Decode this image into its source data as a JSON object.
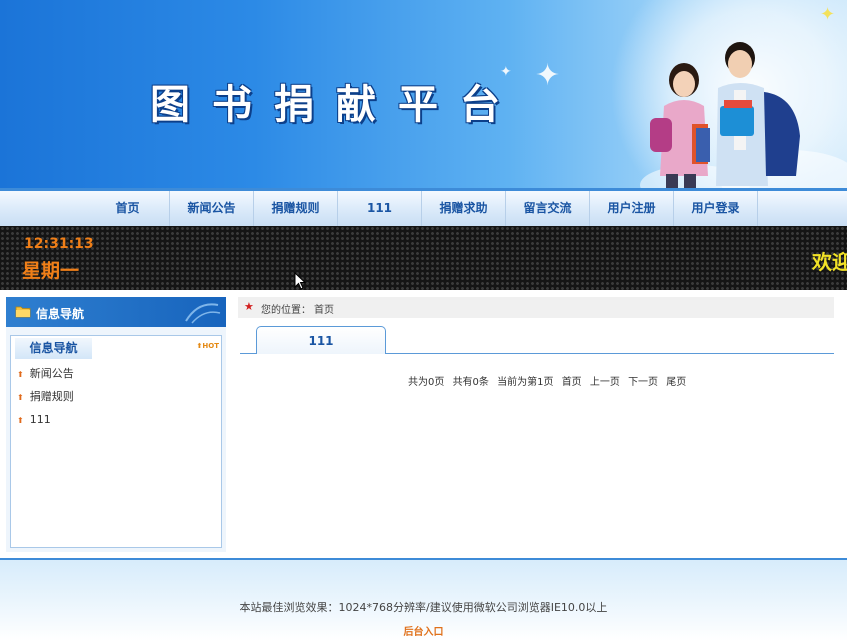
{
  "banner": {
    "title": "图书捐献平台"
  },
  "nav": {
    "items": [
      {
        "label": "首页"
      },
      {
        "label": "新闻公告"
      },
      {
        "label": "捐赠规则"
      },
      {
        "label": "111"
      },
      {
        "label": "捐赠求助"
      },
      {
        "label": "留言交流"
      },
      {
        "label": "用户注册"
      },
      {
        "label": "用户登录"
      }
    ]
  },
  "led": {
    "time": "12:31:13",
    "weekday": "星期一",
    "marquee": "欢迎"
  },
  "sidebar": {
    "header": "信息导航",
    "box_title": "信息导航",
    "hot_badge": "HOT",
    "items": [
      {
        "label": "新闻公告"
      },
      {
        "label": "捐赠规则"
      },
      {
        "label": "111"
      }
    ]
  },
  "breadcrumb": {
    "label": "您的位置：",
    "current": "首页"
  },
  "tab": {
    "label": "111"
  },
  "pager": {
    "total_pages": "共为0页",
    "total_items": "共有0条",
    "current": "当前为第1页",
    "first": "首页",
    "prev": "上一页",
    "next": "下一页",
    "last": "尾页"
  },
  "footer": {
    "note": "本站最佳浏览效果：1024*768分辨率/建议使用微软公司浏览器IE10.0以上",
    "admin_link": "后台入口"
  },
  "colors": {
    "accent": "#1a55a3",
    "banner_blue": "#1b74d8",
    "led_text": "#f07f18",
    "marquee_text": "#f2e227",
    "footer_link": "#e0701a"
  },
  "icons": [
    "folder-icon",
    "arrow-up-icon",
    "star-icon",
    "bullet-arrow-icon",
    "mouse-cursor-icon"
  ]
}
